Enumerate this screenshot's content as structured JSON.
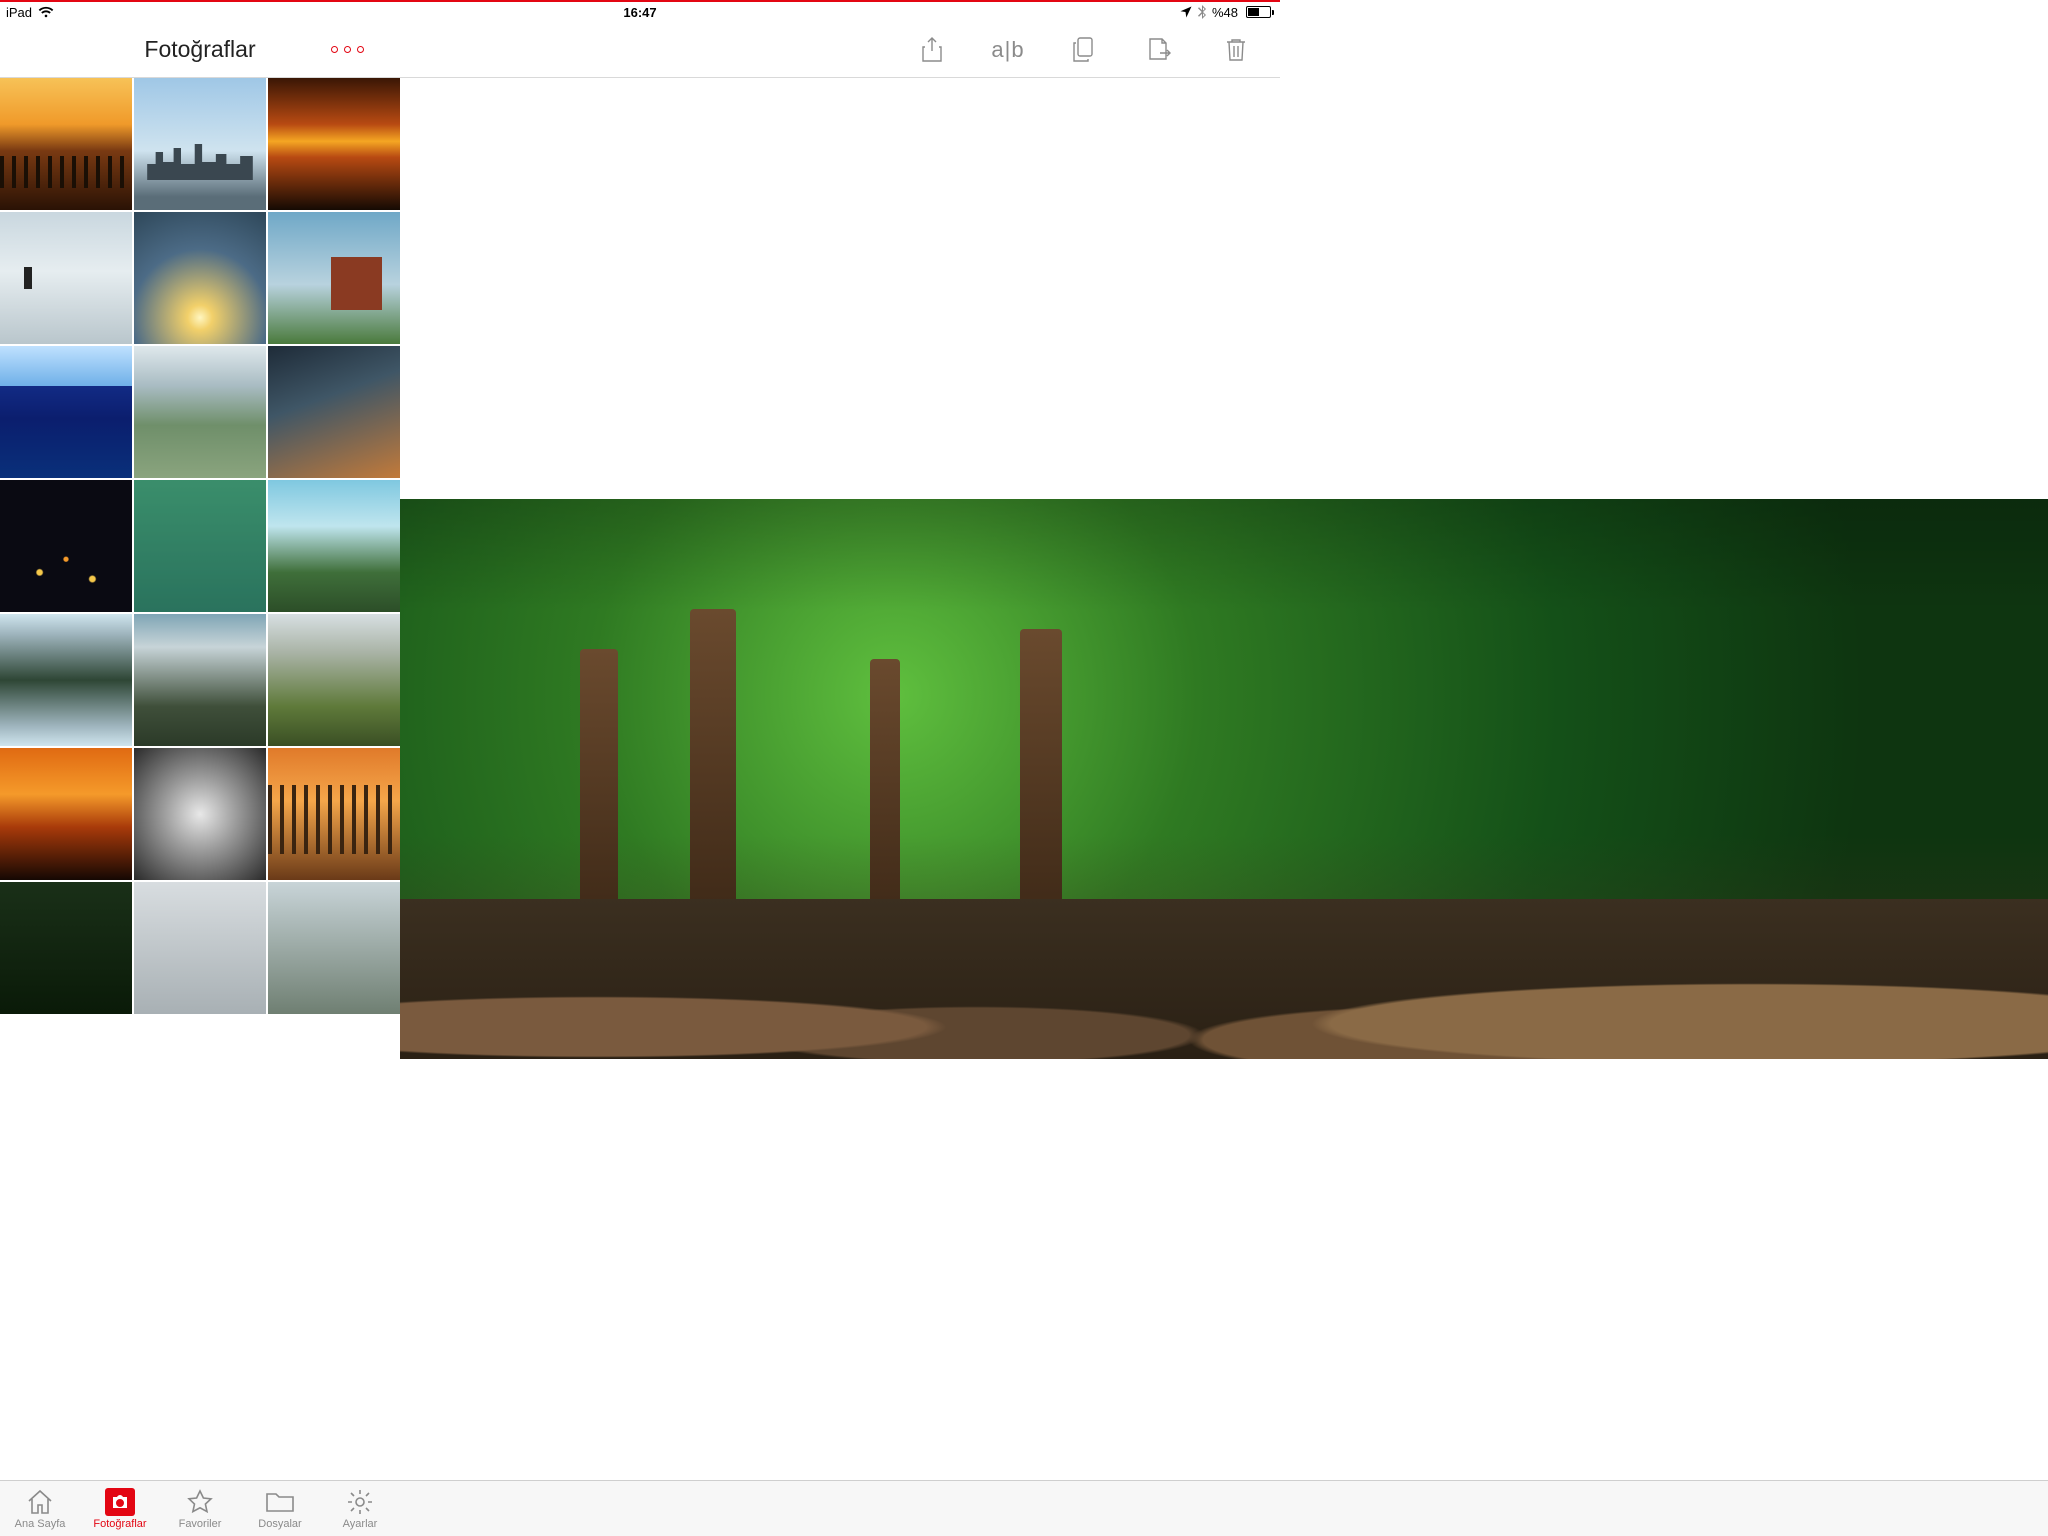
{
  "status": {
    "device": "iPad",
    "time": "16:47",
    "battery_text": "%48"
  },
  "header": {
    "title": "Fotoğraflar",
    "compare_label": "a|b"
  },
  "thumbs": {
    "selected_index": 10
  },
  "tabs": {
    "home": "Ana Sayfa",
    "photos": "Fotoğraflar",
    "favorites": "Favoriler",
    "files": "Dosyalar",
    "settings": "Ayarlar"
  }
}
